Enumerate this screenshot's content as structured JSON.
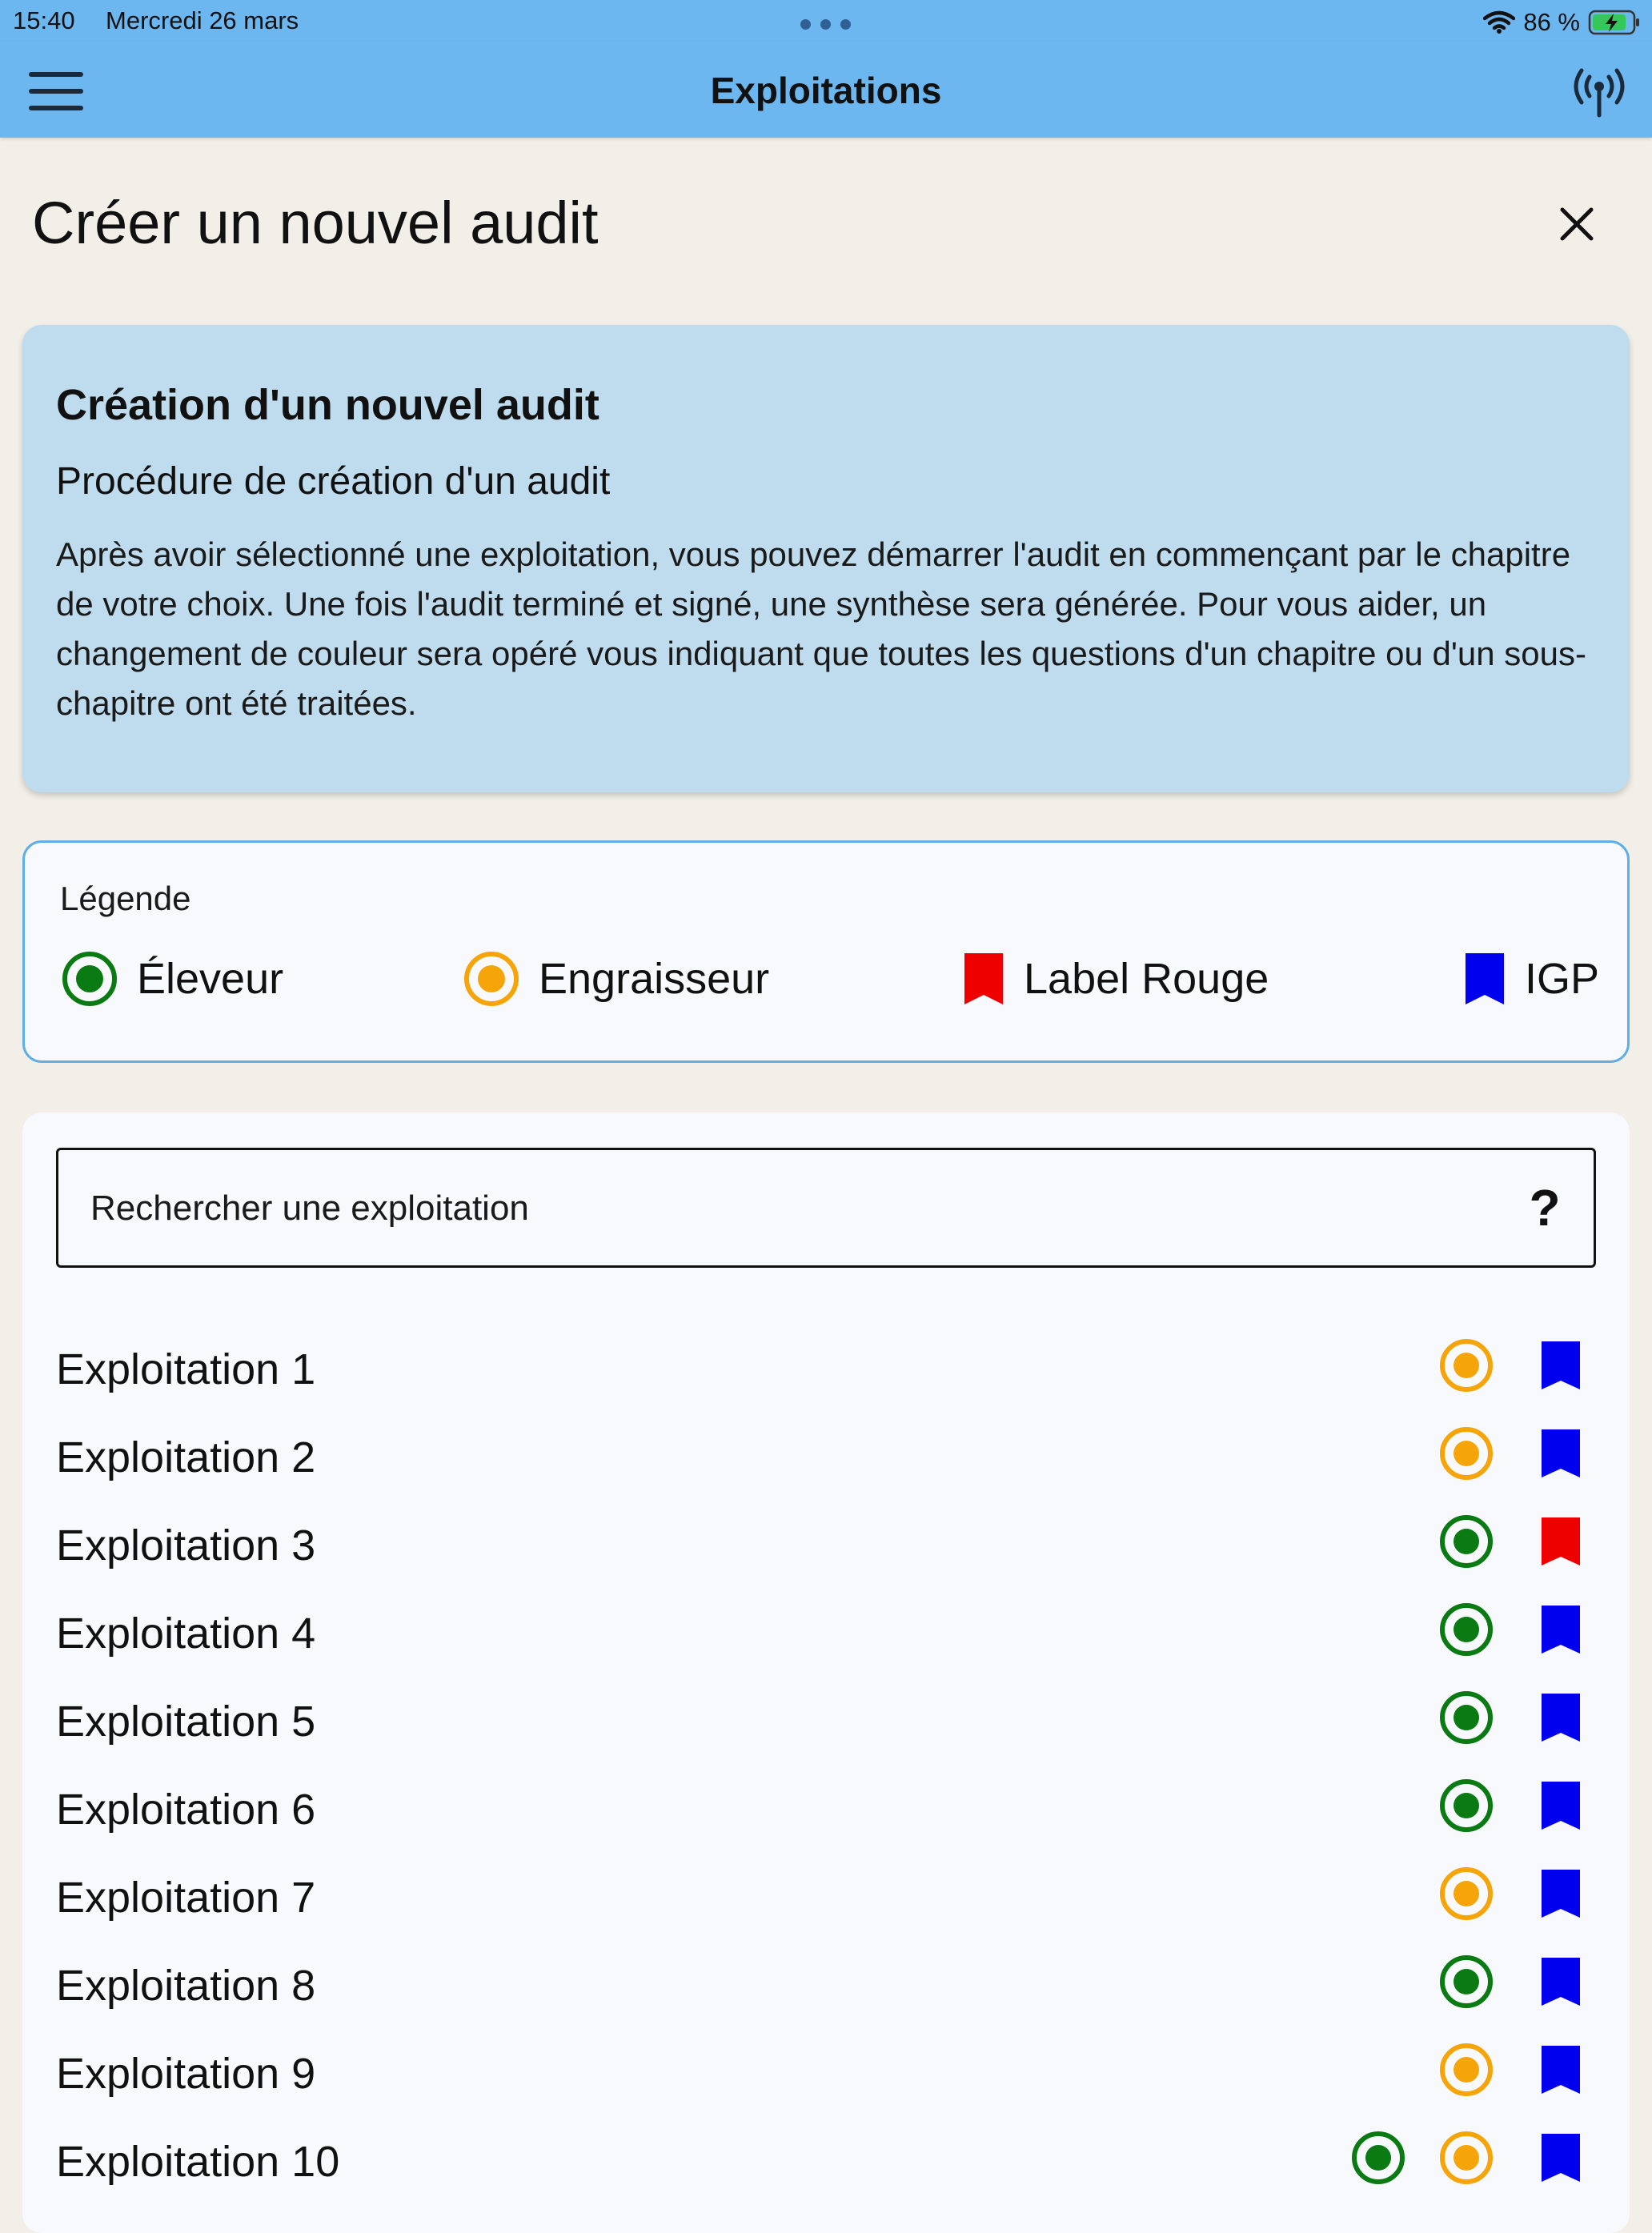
{
  "status_bar": {
    "time": "15:40",
    "date": "Mercredi 26 mars",
    "battery_percent": "86 %",
    "battery_level": 0.86
  },
  "app_bar": {
    "title": "Exploitations"
  },
  "page": {
    "title": "Créer un nouvel audit"
  },
  "info_card": {
    "heading": "Création d'un nouvel audit",
    "subheading": "Procédure de création d'un audit",
    "body": "Après avoir sélectionné une exploitation, vous pouvez démarrer l'audit en commençant par le chapitre de votre choix. Une fois l'audit terminé et signé, une synthèse sera générée. Pour vous aider, un changement de couleur sera opéré vous indiquant que toutes les questions d'un chapitre ou d'un sous-chapitre ont été traitées."
  },
  "legend": {
    "title": "Légende",
    "items": [
      {
        "label": "Éleveur",
        "icon": "radio-dot-icon",
        "color": "#0a7a12"
      },
      {
        "label": "Engraisseur",
        "icon": "radio-dot-icon",
        "color": "#f5a50a"
      },
      {
        "label": "Label Rouge",
        "icon": "bookmark-icon",
        "color": "#ee0000"
      },
      {
        "label": "IGP",
        "icon": "bookmark-icon",
        "color": "#0000ee"
      }
    ]
  },
  "search": {
    "placeholder": "Rechercher une exploitation",
    "help_label": "?"
  },
  "colors": {
    "eleveur": "#0a7a12",
    "engraisseur": "#f5a50a",
    "label_rouge": "#ee0000",
    "igp": "#0000ee",
    "header": "#6db7f1",
    "info_card": "#bfdcee"
  },
  "farms": [
    {
      "name": "Exploitation 1",
      "types": [
        "engraisseur"
      ],
      "label": "igp"
    },
    {
      "name": "Exploitation 2",
      "types": [
        "engraisseur"
      ],
      "label": "igp"
    },
    {
      "name": "Exploitation 3",
      "types": [
        "eleveur"
      ],
      "label": "label_rouge"
    },
    {
      "name": "Exploitation 4",
      "types": [
        "eleveur"
      ],
      "label": "igp"
    },
    {
      "name": "Exploitation 5",
      "types": [
        "eleveur"
      ],
      "label": "igp"
    },
    {
      "name": "Exploitation 6",
      "types": [
        "eleveur"
      ],
      "label": "igp"
    },
    {
      "name": "Exploitation 7",
      "types": [
        "engraisseur"
      ],
      "label": "igp"
    },
    {
      "name": "Exploitation 8",
      "types": [
        "eleveur"
      ],
      "label": "igp"
    },
    {
      "name": "Exploitation 9",
      "types": [
        "engraisseur"
      ],
      "label": "igp"
    },
    {
      "name": "Exploitation 10",
      "types": [
        "eleveur",
        "engraisseur"
      ],
      "label": "igp"
    }
  ]
}
